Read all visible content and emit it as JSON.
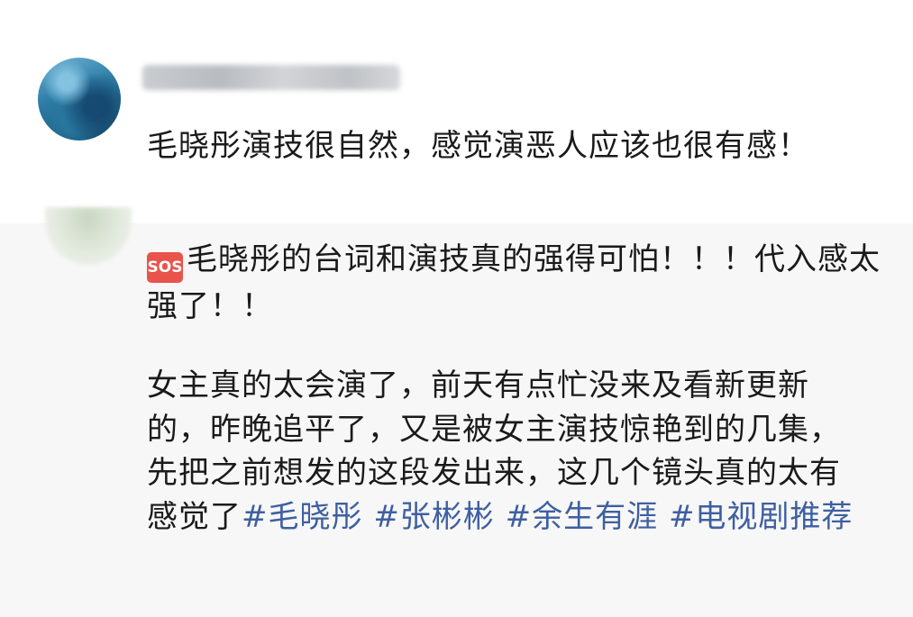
{
  "comment1": {
    "text": "毛晓彤演技很自然，感觉演恶人应该也很有感！"
  },
  "comment2": {
    "badge": "SOS",
    "paragraph1": "毛晓彤的台词和演技真的强得可怕！！！代入感太强了！！",
    "paragraph2": "女主真的太会演了，前天有点忙没来及看新更新的，昨晚追平了，又是被女主演技惊艳到的几集，先把之前想发的这段发出来，这几个镜头真的太有感觉了",
    "hashtags": [
      "#毛晓彤",
      "#张彬彬",
      "#余生有涯",
      "#电视剧推荐"
    ]
  },
  "colors": {
    "hashtag": "#3e5fa1",
    "badge": "#e8534b",
    "text": "#1a1a1a"
  }
}
